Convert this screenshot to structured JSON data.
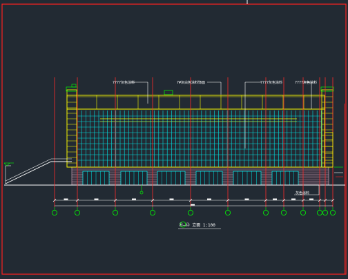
{
  "drawing": {
    "title": "Ⓐ—⑫ 立面 1:100",
    "top_notes": [
      "7777灰色涂料",
      "7#灰白色涂料饰面",
      "7777灰色涂料",
      "7777灰色涂料"
    ],
    "bottom_note": "灰色涂料",
    "left_note": "",
    "axis_labels": [
      "A",
      "B",
      "C",
      "D",
      "E",
      "F",
      "G",
      "H",
      "I",
      "J",
      "K"
    ]
  },
  "colors": {
    "background": "#222a33",
    "frame": "#ff2020",
    "wall": "#ffff00",
    "glass": "#00e5e5",
    "grid": "#ff2a2a",
    "base": "#c8a0b4",
    "text": "#ffffff",
    "axis": "#00ff00"
  }
}
